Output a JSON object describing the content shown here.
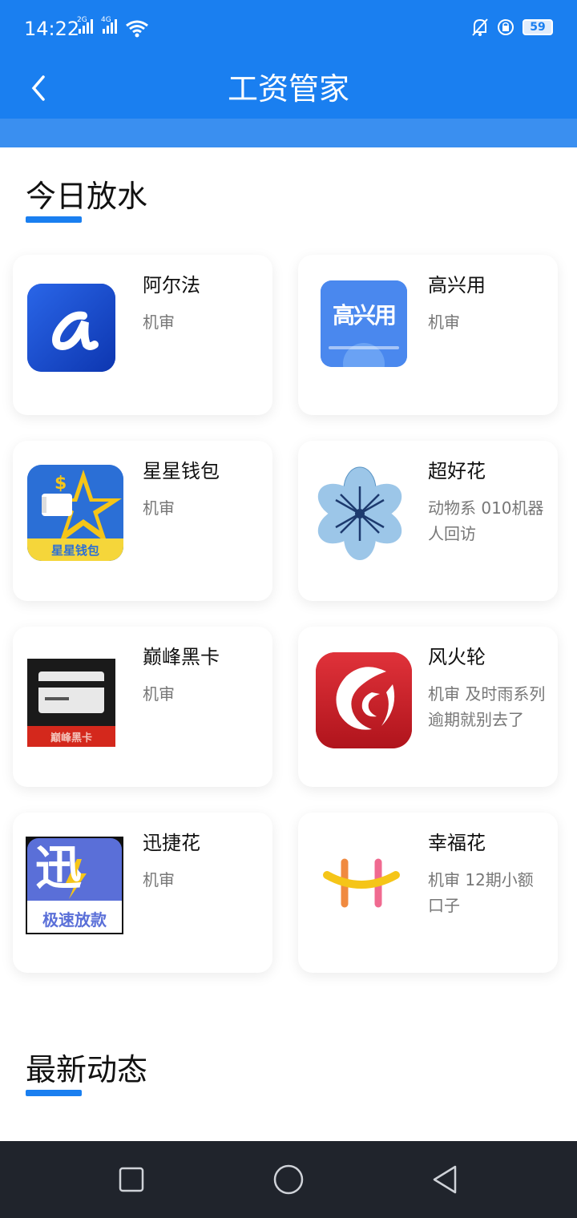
{
  "status": {
    "time": "14:22",
    "net1": "2G",
    "net2": "4G",
    "battery": "59"
  },
  "header": {
    "title": "工资管家"
  },
  "sections": {
    "today": "今日放水",
    "latest": "最新动态"
  },
  "cards": [
    {
      "name": "阿尔法",
      "desc": "机审"
    },
    {
      "name": "高兴用",
      "desc": "机审"
    },
    {
      "name": "星星钱包",
      "desc": "机审"
    },
    {
      "name": "超好花",
      "desc": "动物系 010机器人回访"
    },
    {
      "name": "巅峰黑卡",
      "desc": "机审"
    },
    {
      "name": "风火轮",
      "desc": "机审 及时雨系列逾期就别去了"
    },
    {
      "name": "迅捷花",
      "desc": "机审"
    },
    {
      "name": "幸福花",
      "desc": "机审 12期小额口子"
    }
  ],
  "logos": {
    "gaoxing": "高兴用",
    "xingxing": "星星钱包",
    "dianfeng": "巅峰黑卡",
    "xunjie_big": "迅",
    "xunjie_small": "极速放款"
  },
  "colors": {
    "accent": "#1a7ff0",
    "navbar": "#20242c"
  }
}
